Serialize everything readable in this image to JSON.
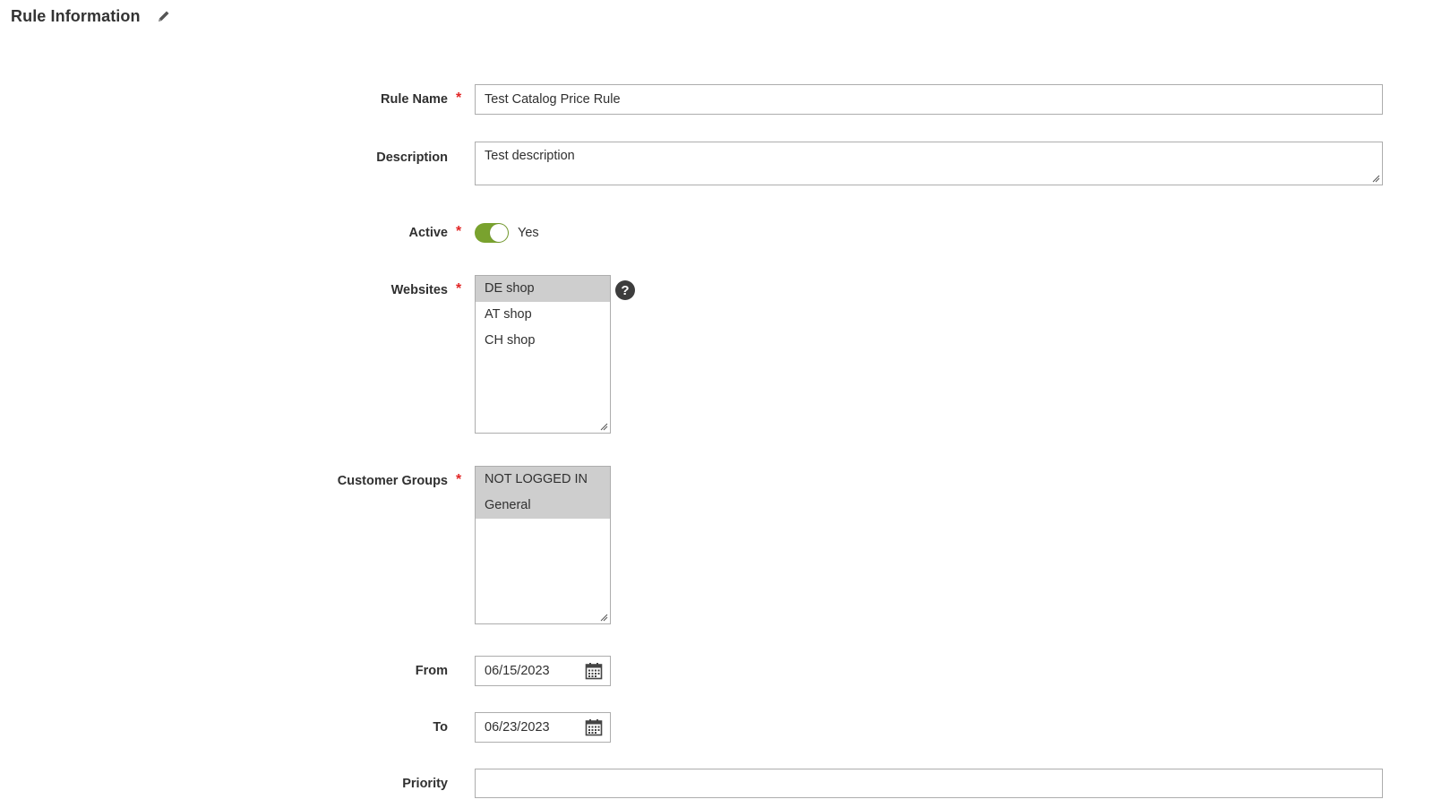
{
  "section": {
    "title": "Rule Information",
    "edit_icon": "pencil-icon"
  },
  "fields": {
    "rule_name": {
      "label": "Rule Name",
      "required": "*",
      "value": "Test Catalog Price Rule"
    },
    "description": {
      "label": "Description",
      "value": "Test description"
    },
    "active": {
      "label": "Active",
      "required": "*",
      "state_label": "Yes",
      "on": true
    },
    "websites": {
      "label": "Websites",
      "required": "*",
      "help_icon": "?",
      "options": [
        {
          "label": "DE shop",
          "selected": true
        },
        {
          "label": "AT shop",
          "selected": false
        },
        {
          "label": "CH shop",
          "selected": false
        }
      ]
    },
    "customer_groups": {
      "label": "Customer Groups",
      "required": "*",
      "options": [
        {
          "label": "NOT LOGGED IN",
          "selected": true
        },
        {
          "label": "General",
          "selected": true
        }
      ]
    },
    "from": {
      "label": "From",
      "value": "06/15/2023"
    },
    "to": {
      "label": "To",
      "value": "06/23/2023"
    },
    "priority": {
      "label": "Priority",
      "value": ""
    }
  },
  "colors": {
    "required": "#e22626",
    "toggle_on": "#79a22e",
    "selected_option": "#cecece",
    "border": "#adadad"
  }
}
